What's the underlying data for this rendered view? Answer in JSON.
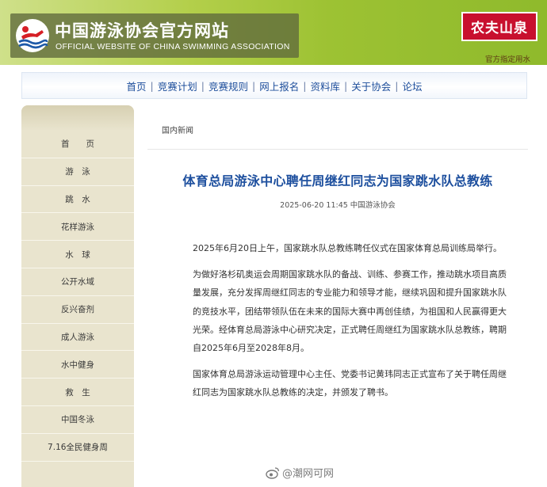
{
  "header": {
    "site_title": "中国游泳协会官方网站",
    "site_subtitle": "OFFICIAL WEBSITE OF CHINA SWIMMING ASSOCIATION",
    "sponsor_name": "农夫山泉",
    "sponsor_slogan": "官方指定用水"
  },
  "nav": {
    "items": [
      {
        "label": "首页"
      },
      {
        "label": "竞赛计划"
      },
      {
        "label": "竞赛规则"
      },
      {
        "label": "网上报名"
      },
      {
        "label": "资料库"
      },
      {
        "label": "关于协会"
      },
      {
        "label": "论坛"
      }
    ],
    "separator": "|"
  },
  "sidebar": {
    "items": [
      {
        "label": "首　　页"
      },
      {
        "label": "游　泳"
      },
      {
        "label": "跳　水"
      },
      {
        "label": "花样游泳"
      },
      {
        "label": "水　球"
      },
      {
        "label": "公开水域"
      },
      {
        "label": "反兴奋剂"
      },
      {
        "label": "成人游泳"
      },
      {
        "label": "水中健身"
      },
      {
        "label": "救　生"
      },
      {
        "label": "中国冬泳"
      },
      {
        "label": "7.16全民健身周"
      }
    ]
  },
  "breadcrumb": "国内新闻",
  "article": {
    "title": "体育总局游泳中心聘任周继红同志为国家跳水队总教练",
    "meta": "2025-06-20 11:45 中国游泳协会",
    "paragraphs": [
      "2025年6月20日上午，国家跳水队总教练聘任仪式在国家体育总局训练局举行。",
      "为做好洛杉矶奥运会周期国家跳水队的备战、训练、参赛工作，推动跳水项目高质量发展，充分发挥周继红同志的专业能力和领导才能，继续巩固和提升国家跳水队的竞技水平，团结带领队伍在未来的国际大赛中再创佳绩，为祖国和人民赢得更大光荣。经体育总局游泳中心研究决定，正式聘任周继红为国家跳水队总教练，聘期自2025年6月至2028年8月。",
      "国家体育总局游泳运动管理中心主任、党委书记黄玮同志正式宣布了关于聘任周继红同志为国家跳水队总教练的决定，并颁发了聘书。"
    ]
  },
  "watermark": {
    "text": "@潮网可网",
    "icon": "weibo-icon"
  },
  "colors": {
    "header_green": "#9dc233",
    "nav_link": "#1c4d9b",
    "title_blue": "#1d4f9e",
    "sidebar_bg": "#e9e4ce",
    "sponsor_red": "#c8102e"
  }
}
